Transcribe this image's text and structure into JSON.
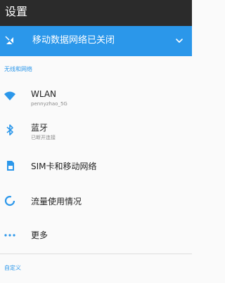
{
  "app_bar": {
    "title": "设置"
  },
  "banner": {
    "icon": "mobile-data-off-icon",
    "text": "移动数据网络已关闭",
    "color": "#2b97ea"
  },
  "sections": [
    {
      "header": "无线和网络",
      "items": [
        {
          "icon": "wifi-icon",
          "label": "WLAN",
          "subtitle": "pennyzhao_5G"
        },
        {
          "icon": "bluetooth-icon",
          "label": "蓝牙",
          "subtitle": "已断开连接"
        },
        {
          "icon": "sim-card-icon",
          "label": "SIM卡和移动网络"
        },
        {
          "icon": "data-usage-icon",
          "label": "流量使用情况"
        },
        {
          "icon": "more-icon",
          "label": "更多"
        }
      ]
    },
    {
      "header": "自定义"
    }
  ]
}
